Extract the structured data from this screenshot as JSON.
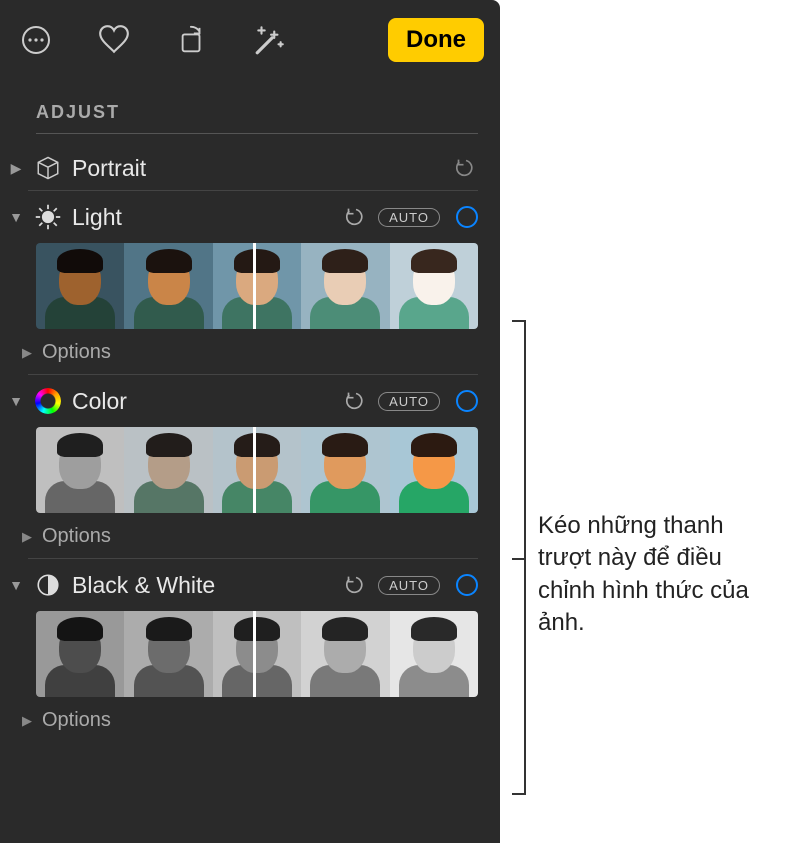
{
  "toolbar": {
    "done_label": "Done"
  },
  "section_title": "ADJUST",
  "groups": {
    "portrait": {
      "label": "Portrait",
      "expanded": false
    },
    "light": {
      "label": "Light",
      "auto_label": "AUTO",
      "options_label": "Options",
      "expanded": true
    },
    "color": {
      "label": "Color",
      "auto_label": "AUTO",
      "options_label": "Options",
      "expanded": true
    },
    "bw": {
      "label": "Black & White",
      "auto_label": "AUTO",
      "options_label": "Options",
      "expanded": true
    }
  },
  "callout_text": "Kéo những thanh trượt này để điều chỉnh hình thức của ảnh.",
  "colors": {
    "accent": "#0a84ff",
    "done_bg": "#ffcc00"
  }
}
